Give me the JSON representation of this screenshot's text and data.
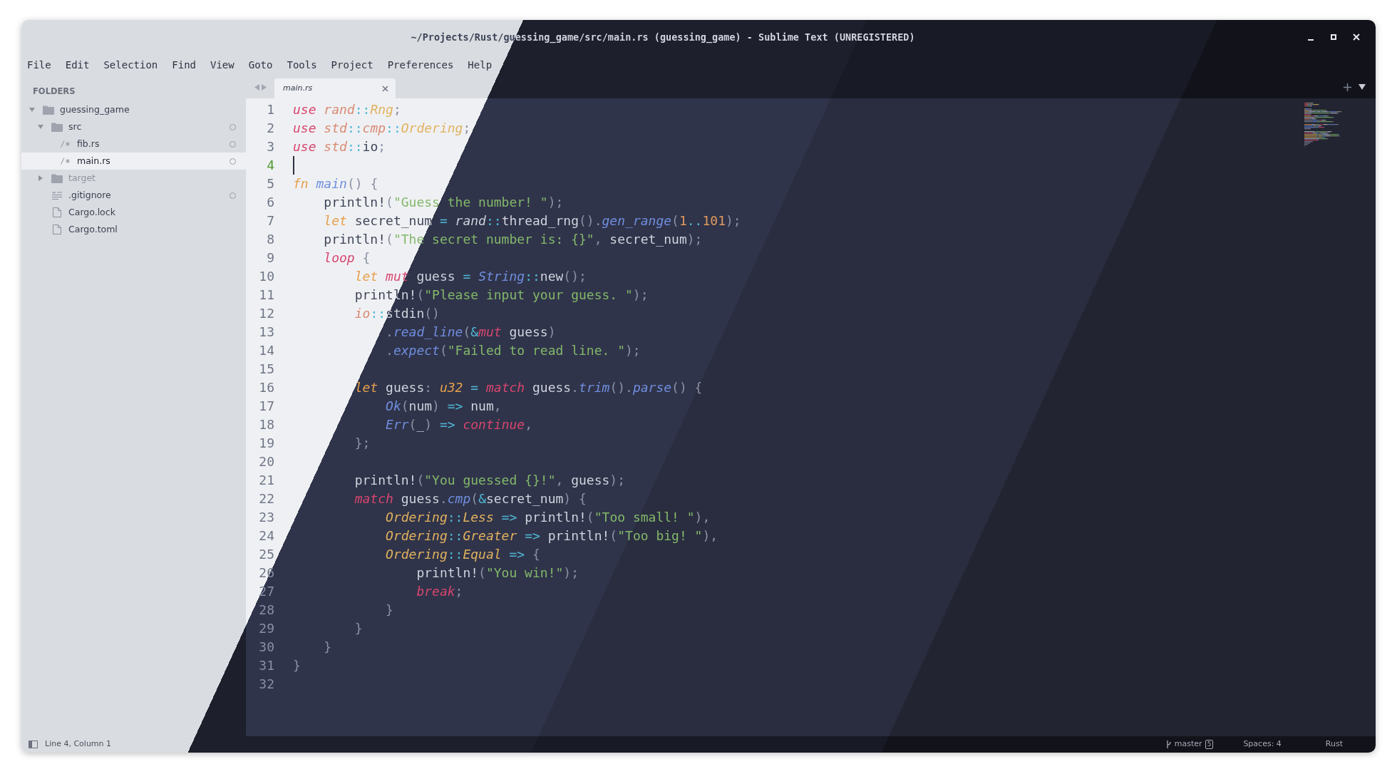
{
  "window": {
    "title": "~/Projects/Rust/guessing_game/src/main.rs (guessing_game) - Sublime Text (UNREGISTERED)"
  },
  "menu": [
    "File",
    "Edit",
    "Selection",
    "Find",
    "View",
    "Goto",
    "Tools",
    "Project",
    "Preferences",
    "Help"
  ],
  "sidebar": {
    "heading": "FOLDERS",
    "tree": [
      {
        "name": "guessing_game",
        "kind": "folder",
        "expanded": true,
        "selected": false,
        "marked": false,
        "children": [
          {
            "name": "src",
            "kind": "folder",
            "expanded": true,
            "selected": false,
            "marked": true,
            "children": [
              {
                "name": "fib.rs",
                "kind": "source",
                "selected": false,
                "marked": true
              },
              {
                "name": "main.rs",
                "kind": "source",
                "selected": true,
                "marked": true
              }
            ]
          },
          {
            "name": "target",
            "kind": "folder",
            "expanded": false,
            "selected": false,
            "marked": false,
            "ignored": true
          },
          {
            "name": ".gitignore",
            "kind": "text",
            "selected": false,
            "marked": true
          },
          {
            "name": "Cargo.lock",
            "kind": "file",
            "selected": false,
            "marked": false
          },
          {
            "name": "Cargo.toml",
            "kind": "file",
            "selected": false,
            "marked": false
          }
        ]
      }
    ]
  },
  "tabs": [
    {
      "label": "main.rs",
      "selected": true
    }
  ],
  "editor": {
    "lines": [
      {
        "number": "1",
        "current": false,
        "tokens": [
          {
            "text": "use",
            "kind": "kw"
          },
          {
            "text": " rand",
            "kind": "module"
          },
          {
            "text": "::",
            "kind": "op"
          },
          {
            "text": "Rng",
            "kind": "type"
          },
          {
            "text": ";",
            "kind": "punct"
          }
        ]
      },
      {
        "number": "2",
        "current": false,
        "tokens": [
          {
            "text": "use",
            "kind": "kw"
          },
          {
            "text": " std",
            "kind": "module"
          },
          {
            "text": "::",
            "kind": "op"
          },
          {
            "text": "cmp",
            "kind": "module"
          },
          {
            "text": "::",
            "kind": "op"
          },
          {
            "text": "Ordering",
            "kind": "type"
          },
          {
            "text": ";",
            "kind": "punct"
          }
        ]
      },
      {
        "number": "3",
        "current": false,
        "tokens": [
          {
            "text": "use",
            "kind": "kw"
          },
          {
            "text": " std",
            "kind": "module"
          },
          {
            "text": "::",
            "kind": "op"
          },
          {
            "text": "io",
            "kind": "plain"
          },
          {
            "text": ";",
            "kind": "punct"
          }
        ]
      },
      {
        "number": "4",
        "current": true
      },
      {
        "number": "5",
        "current": false,
        "tokens": [
          {
            "text": "fn",
            "kind": "storage"
          },
          {
            "text": " main",
            "kind": "fn"
          },
          {
            "text": "() {",
            "kind": "punct"
          }
        ]
      },
      {
        "number": "6",
        "current": false,
        "tokens": [
          {
            "text": "    println!",
            "kind": "plain"
          },
          {
            "text": "(",
            "kind": "punct"
          },
          {
            "text": "\"Guess the number! \"",
            "kind": "string"
          },
          {
            "text": ");",
            "kind": "punct"
          }
        ]
      },
      {
        "number": "7",
        "current": false,
        "tokens": [
          {
            "text": "    let",
            "kind": "storage"
          },
          {
            "text": " secret_num",
            "kind": "plain"
          },
          {
            "text": " =",
            "kind": "op"
          },
          {
            "text": " rand",
            "kind": "path"
          },
          {
            "text": "::",
            "kind": "op"
          },
          {
            "text": "thread_rng",
            "kind": "plain"
          },
          {
            "text": "().",
            "kind": "punct"
          },
          {
            "text": "gen_range",
            "kind": "fn"
          },
          {
            "text": "(",
            "kind": "punct"
          },
          {
            "text": "1",
            "kind": "number"
          },
          {
            "text": "..",
            "kind": "op"
          },
          {
            "text": "101",
            "kind": "number"
          },
          {
            "text": ");",
            "kind": "punct"
          }
        ]
      },
      {
        "number": "8",
        "current": false,
        "tokens": [
          {
            "text": "    println!",
            "kind": "plain"
          },
          {
            "text": "(",
            "kind": "punct"
          },
          {
            "text": "\"The secret number is: {}\"",
            "kind": "string"
          },
          {
            "text": ", ",
            "kind": "punct"
          },
          {
            "text": "secret_num",
            "kind": "plain"
          },
          {
            "text": ");",
            "kind": "punct"
          }
        ]
      },
      {
        "number": "9",
        "current": false,
        "tokens": [
          {
            "text": "    loop",
            "kind": "kw"
          },
          {
            "text": " {",
            "kind": "punct"
          }
        ]
      },
      {
        "number": "10",
        "current": false,
        "tokens": [
          {
            "text": "        let",
            "kind": "storage"
          },
          {
            "text": " mut",
            "kind": "kw"
          },
          {
            "text": " guess",
            "kind": "plain"
          },
          {
            "text": " =",
            "kind": "op"
          },
          {
            "text": " String",
            "kind": "fn"
          },
          {
            "text": "::",
            "kind": "op"
          },
          {
            "text": "new",
            "kind": "plain"
          },
          {
            "text": "();",
            "kind": "punct"
          }
        ]
      },
      {
        "number": "11",
        "current": false,
        "tokens": [
          {
            "text": "        println!",
            "kind": "plain"
          },
          {
            "text": "(",
            "kind": "punct"
          },
          {
            "text": "\"Please input your guess. \"",
            "kind": "string"
          },
          {
            "text": ");",
            "kind": "punct"
          }
        ]
      },
      {
        "number": "12",
        "current": false,
        "tokens": [
          {
            "text": "        io",
            "kind": "module"
          },
          {
            "text": "::",
            "kind": "op"
          },
          {
            "text": "stdin",
            "kind": "plain"
          },
          {
            "text": "()",
            "kind": "punct"
          }
        ]
      },
      {
        "number": "13",
        "current": false,
        "tokens": [
          {
            "text": "            .",
            "kind": "punct"
          },
          {
            "text": "read_line",
            "kind": "fn"
          },
          {
            "text": "(",
            "kind": "punct"
          },
          {
            "text": "&",
            "kind": "op"
          },
          {
            "text": "mut",
            "kind": "kw"
          },
          {
            "text": " guess",
            "kind": "plain"
          },
          {
            "text": ")",
            "kind": "punct"
          }
        ]
      },
      {
        "number": "14",
        "current": false,
        "tokens": [
          {
            "text": "            .",
            "kind": "punct"
          },
          {
            "text": "expect",
            "kind": "fn"
          },
          {
            "text": "(",
            "kind": "punct"
          },
          {
            "text": "\"Failed to read line. \"",
            "kind": "string"
          },
          {
            "text": ");",
            "kind": "punct"
          }
        ]
      },
      {
        "number": "15",
        "current": false
      },
      {
        "number": "16",
        "current": false,
        "tokens": [
          {
            "text": "        let",
            "kind": "storage"
          },
          {
            "text": " guess",
            "kind": "plain"
          },
          {
            "text": ":",
            "kind": "punct"
          },
          {
            "text": " u32",
            "kind": "storage"
          },
          {
            "text": " =",
            "kind": "op"
          },
          {
            "text": " match",
            "kind": "kw"
          },
          {
            "text": " guess",
            "kind": "plain"
          },
          {
            "text": ".",
            "kind": "punct"
          },
          {
            "text": "trim",
            "kind": "fn"
          },
          {
            "text": "().",
            "kind": "punct"
          },
          {
            "text": "parse",
            "kind": "fn"
          },
          {
            "text": "() {",
            "kind": "punct"
          }
        ]
      },
      {
        "number": "17",
        "current": false,
        "tokens": [
          {
            "text": "            Ok",
            "kind": "fn"
          },
          {
            "text": "(",
            "kind": "punct"
          },
          {
            "text": "num",
            "kind": "plain"
          },
          {
            "text": ")",
            "kind": "punct"
          },
          {
            "text": " =>",
            "kind": "op"
          },
          {
            "text": " num",
            "kind": "plain"
          },
          {
            "text": ",",
            "kind": "punct"
          }
        ]
      },
      {
        "number": "18",
        "current": false,
        "tokens": [
          {
            "text": "            Err",
            "kind": "fn"
          },
          {
            "text": "(",
            "kind": "punct"
          },
          {
            "text": "_",
            "kind": "plain"
          },
          {
            "text": ")",
            "kind": "punct"
          },
          {
            "text": " =>",
            "kind": "op"
          },
          {
            "text": " continue",
            "kind": "kw"
          },
          {
            "text": ",",
            "kind": "punct"
          }
        ]
      },
      {
        "number": "19",
        "current": false,
        "tokens": [
          {
            "text": "        };",
            "kind": "punct"
          }
        ]
      },
      {
        "number": "20",
        "current": false
      },
      {
        "number": "21",
        "current": false,
        "tokens": [
          {
            "text": "        println!",
            "kind": "plain"
          },
          {
            "text": "(",
            "kind": "punct"
          },
          {
            "text": "\"You guessed {}!\"",
            "kind": "string"
          },
          {
            "text": ", ",
            "kind": "punct"
          },
          {
            "text": "guess",
            "kind": "plain"
          },
          {
            "text": ");",
            "kind": "punct"
          }
        ]
      },
      {
        "number": "22",
        "current": false,
        "tokens": [
          {
            "text": "        match",
            "kind": "kw"
          },
          {
            "text": " guess",
            "kind": "plain"
          },
          {
            "text": ".",
            "kind": "punct"
          },
          {
            "text": "cmp",
            "kind": "fn"
          },
          {
            "text": "(",
            "kind": "punct"
          },
          {
            "text": "&",
            "kind": "op"
          },
          {
            "text": "secret_num",
            "kind": "plain"
          },
          {
            "text": ") {",
            "kind": "punct"
          }
        ]
      },
      {
        "number": "23",
        "current": false,
        "tokens": [
          {
            "text": "            Ordering",
            "kind": "type"
          },
          {
            "text": "::",
            "kind": "op"
          },
          {
            "text": "Less",
            "kind": "type"
          },
          {
            "text": " =>",
            "kind": "op"
          },
          {
            "text": " println!",
            "kind": "plain"
          },
          {
            "text": "(",
            "kind": "punct"
          },
          {
            "text": "\"Too small! \"",
            "kind": "string"
          },
          {
            "text": "),",
            "kind": "punct"
          }
        ]
      },
      {
        "number": "24",
        "current": false,
        "tokens": [
          {
            "text": "            Ordering",
            "kind": "type"
          },
          {
            "text": "::",
            "kind": "op"
          },
          {
            "text": "Greater",
            "kind": "type"
          },
          {
            "text": " =>",
            "kind": "op"
          },
          {
            "text": " println!",
            "kind": "plain"
          },
          {
            "text": "(",
            "kind": "punct"
          },
          {
            "text": "\"Too big! \"",
            "kind": "string"
          },
          {
            "text": "),",
            "kind": "punct"
          }
        ]
      },
      {
        "number": "25",
        "current": false,
        "tokens": [
          {
            "text": "            Ordering",
            "kind": "type"
          },
          {
            "text": "::",
            "kind": "op"
          },
          {
            "text": "Equal",
            "kind": "type"
          },
          {
            "text": " =>",
            "kind": "op"
          },
          {
            "text": " {",
            "kind": "punct"
          }
        ]
      },
      {
        "number": "26",
        "current": false,
        "tokens": [
          {
            "text": "                println!",
            "kind": "plain"
          },
          {
            "text": "(",
            "kind": "punct"
          },
          {
            "text": "\"You win!\"",
            "kind": "string"
          },
          {
            "text": ");",
            "kind": "punct"
          }
        ]
      },
      {
        "number": "27",
        "current": false,
        "tokens": [
          {
            "text": "                break",
            "kind": "kw"
          },
          {
            "text": ";",
            "kind": "punct"
          }
        ]
      },
      {
        "number": "28",
        "current": false,
        "tokens": [
          {
            "text": "            }",
            "kind": "punct"
          }
        ]
      },
      {
        "number": "29",
        "current": false,
        "tokens": [
          {
            "text": "        }",
            "kind": "punct"
          }
        ]
      },
      {
        "number": "30",
        "current": false,
        "tokens": [
          {
            "text": "    }",
            "kind": "punct"
          }
        ]
      },
      {
        "number": "31",
        "current": false,
        "tokens": [
          {
            "text": "}",
            "kind": "punct"
          }
        ]
      },
      {
        "number": "32",
        "current": false
      }
    ]
  },
  "status_bar": {
    "position": "Line 4, Column 1",
    "branch": "master",
    "branch_badge": "5",
    "indentation": "Spaces: 4",
    "syntax": "Rust"
  }
}
